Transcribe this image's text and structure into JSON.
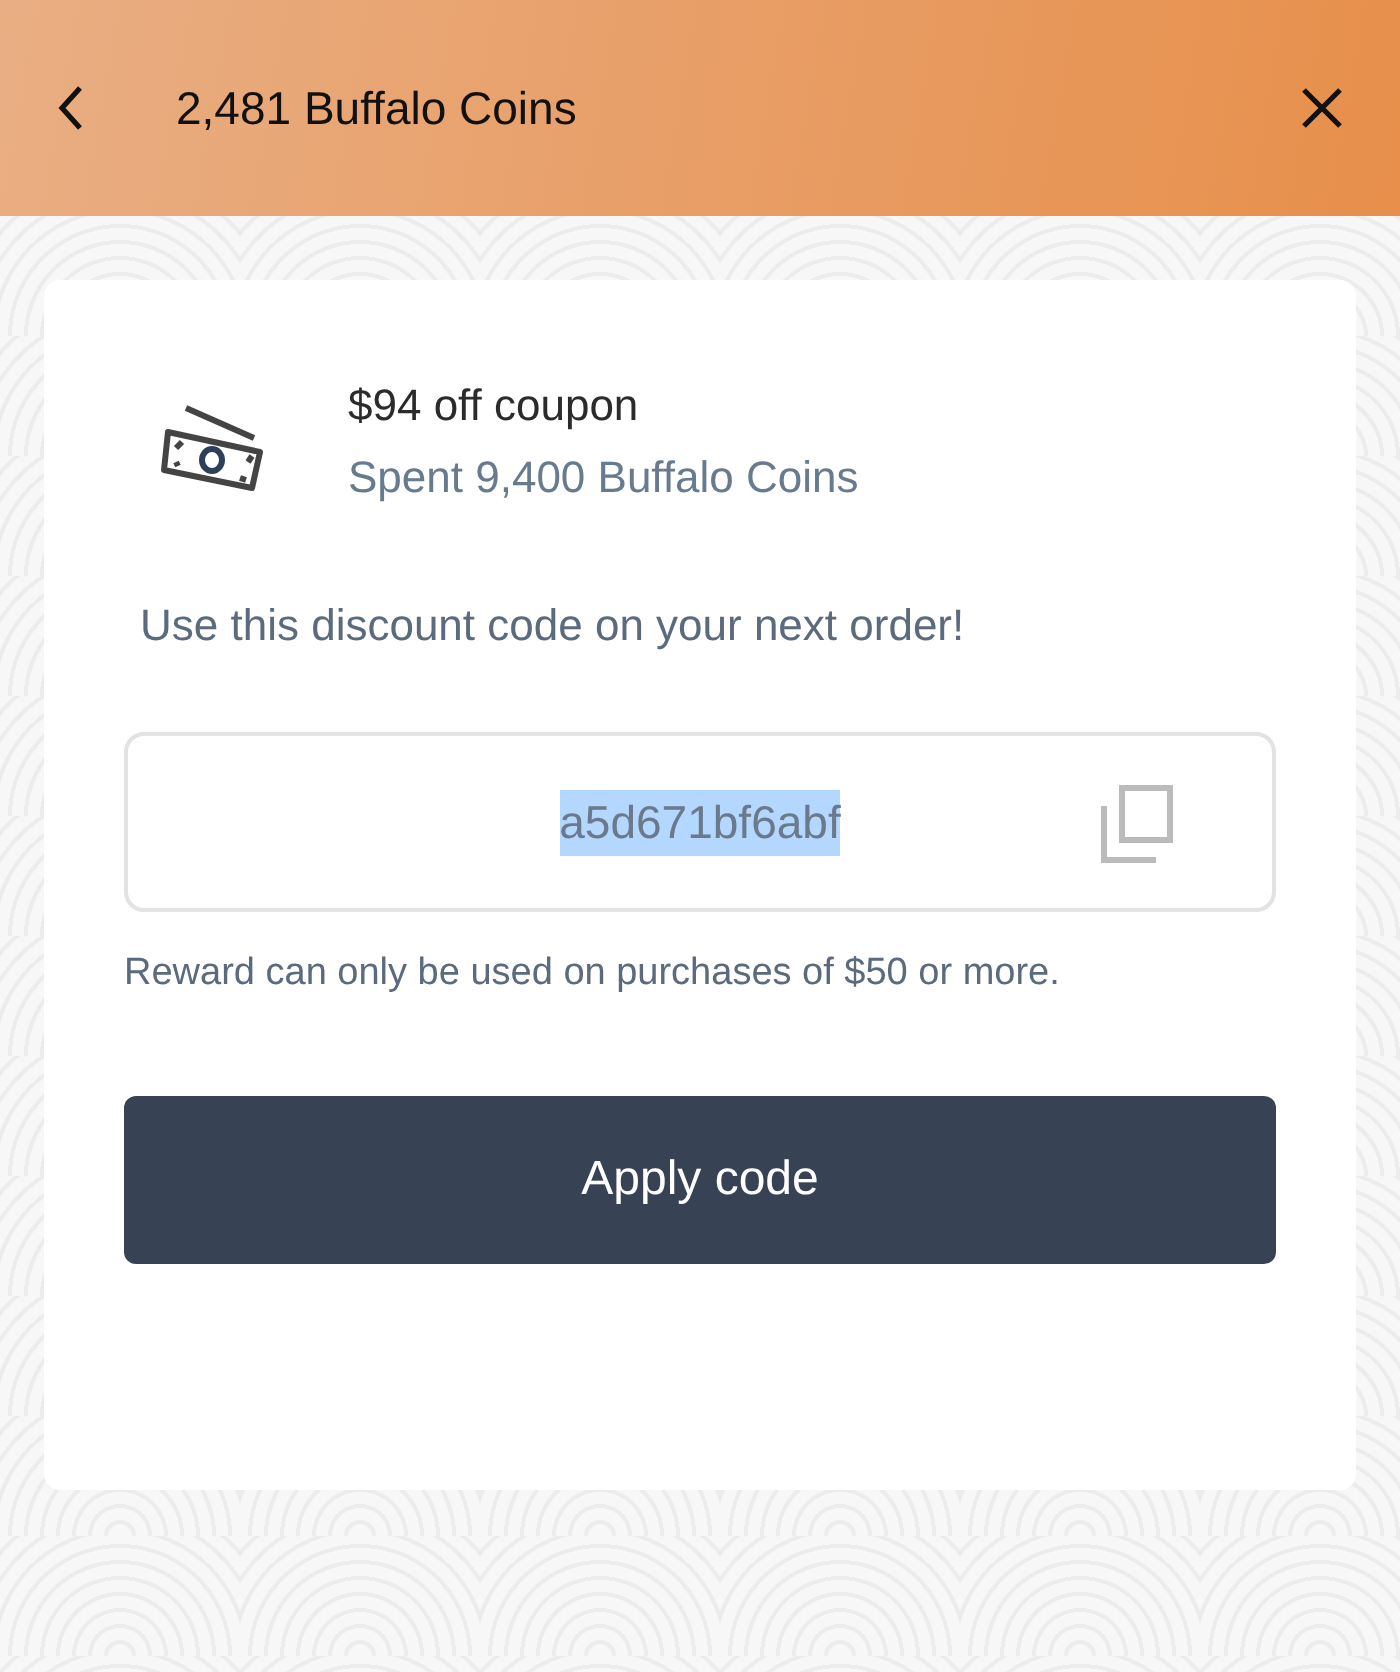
{
  "header": {
    "title": "2,481 Buffalo Coins"
  },
  "reward": {
    "title": "$94 off coupon",
    "subtitle": "Spent 9,400 Buffalo Coins"
  },
  "instruction": "Use this discount code on your next order!",
  "code_field": {
    "value": "a5d671bf6abf",
    "selected": true
  },
  "note": "Reward can only be used on purchases of $50 or more.",
  "apply_button": "Apply code"
}
